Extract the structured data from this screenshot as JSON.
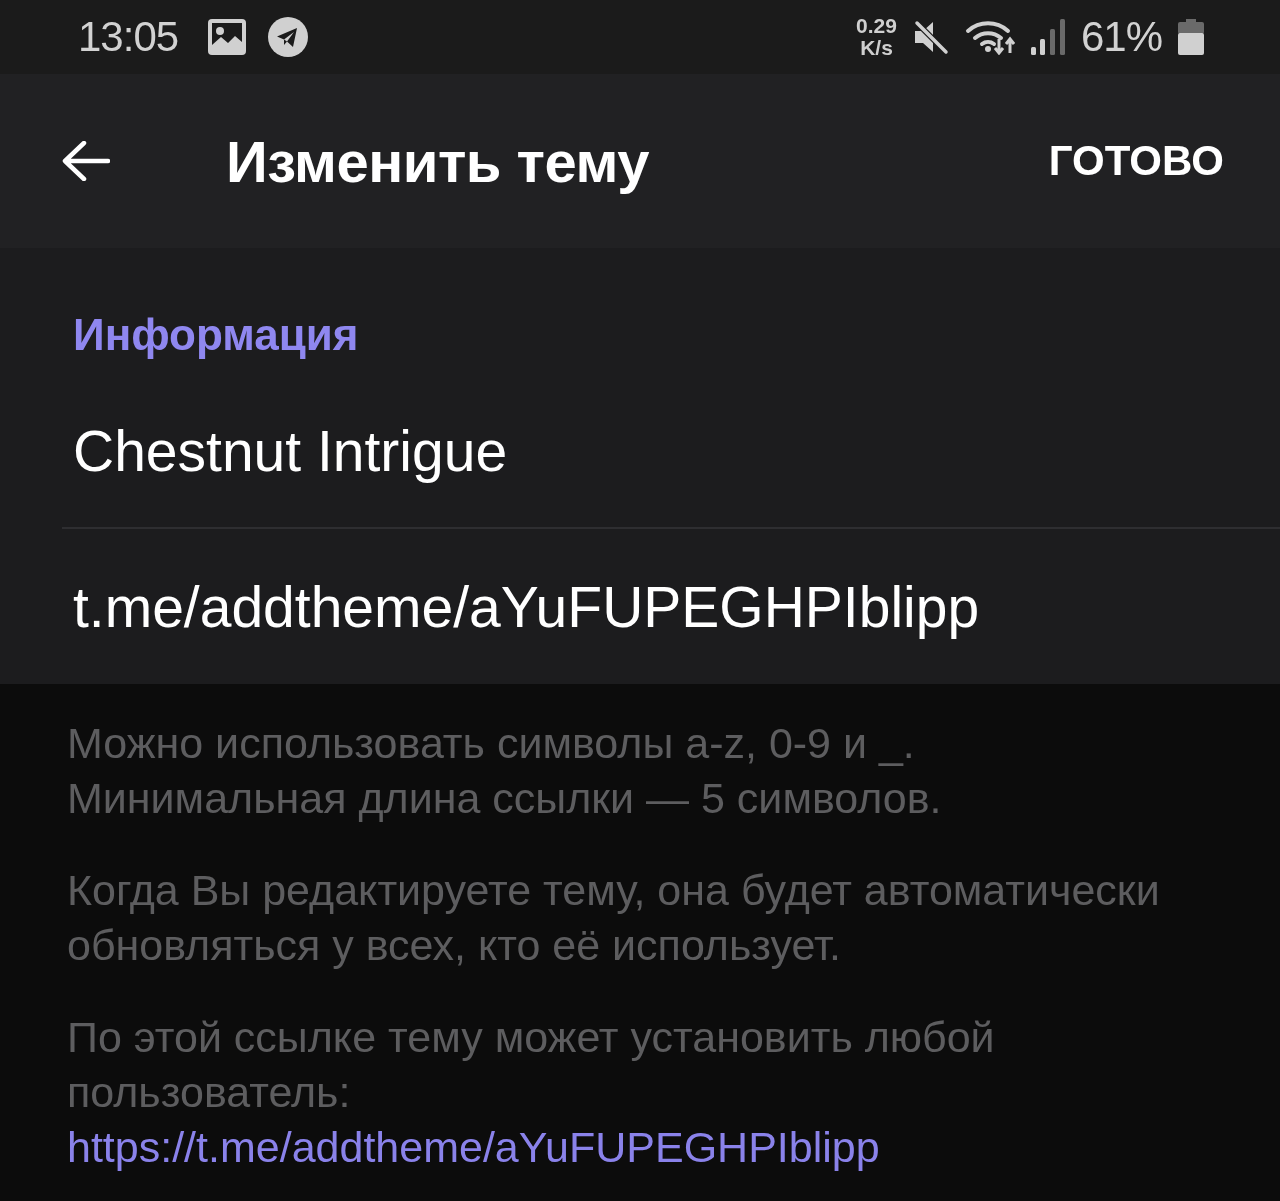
{
  "status_bar": {
    "time": "13:05",
    "net_speed": {
      "value": "0.29",
      "unit": "K/s"
    },
    "battery": "61%"
  },
  "toolbar": {
    "title": "Изменить тему",
    "action": "ГОТОВО"
  },
  "section": {
    "header": "Информация",
    "name_field": {
      "value": "Chestnut Intrigue"
    },
    "link_field": {
      "value": "t.me/addtheme/aYuFUPEGHPIblipp"
    }
  },
  "hints": [
    {
      "text": "Можно использовать символы a-z, 0-9 и _.\nМинимальная длина ссылки — 5 символов."
    },
    {
      "text": "Когда Вы редактируете тему, она будет автоматически\nобновляться у всех, кто её использует."
    },
    {
      "text": "По этой ссылке тему может установить любой\nпользователь:",
      "link": "https://t.me/addtheme/aYuFUPEGHPIblipp"
    }
  ]
}
